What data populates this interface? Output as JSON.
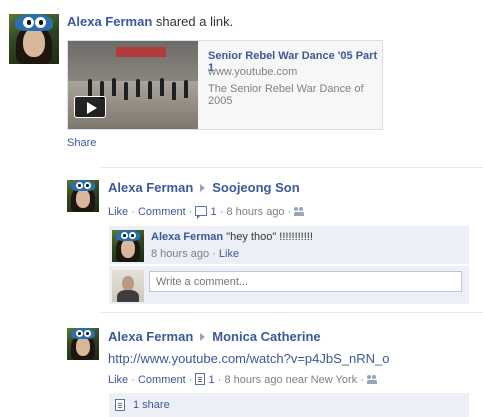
{
  "post": {
    "author": "Alexa Ferman",
    "action": "shared a link.",
    "link": {
      "title": "Senior Rebel War Dance '05 Part 1",
      "domain": "www.youtube.com",
      "description": "The Senior Rebel War Dance of 2005"
    },
    "share_label": "Share"
  },
  "stories": [
    {
      "author": "Alexa Ferman",
      "target": "Soojeong Son",
      "like": "Like",
      "dot1": "·",
      "comment": "Comment",
      "dot2": "·",
      "comment_count": "1",
      "dot3": "·",
      "time": "8 hours ago",
      "dot4": "·",
      "comments": [
        {
          "author": "Alexa Ferman",
          "text": "\"hey thoo\" !!!!!!!!!!!",
          "time": "8 hours ago",
          "dot": "·",
          "like": "Like"
        }
      ],
      "comment_placeholder": "Write a comment..."
    },
    {
      "author": "Alexa Ferman",
      "target": "Monica Catherine",
      "body": "http://www.youtube.com/watch?v=p4JbS_nRN_o",
      "like": "Like",
      "dot1": "·",
      "comment": "Comment",
      "dot2": "·",
      "comment_count": "1",
      "dot3": "·",
      "time": "8 hours ago near New York",
      "dot4": "·",
      "share_count": "1 share"
    }
  ],
  "colors": {
    "link": "#3b5998",
    "meta": "#808080",
    "comment_bg": "#eceff5"
  }
}
